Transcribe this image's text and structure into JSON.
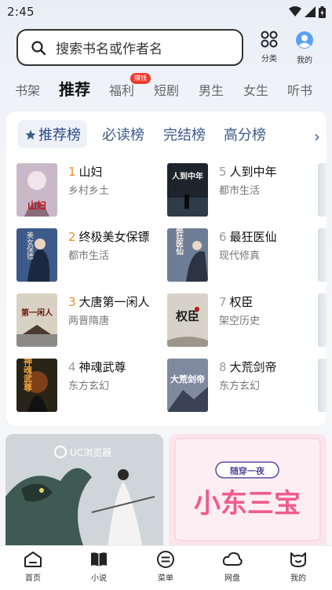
{
  "status": {
    "time": "2:45"
  },
  "search": {
    "placeholder": "搜索书名或作者名",
    "category_label": "分类",
    "profile_label": "我的"
  },
  "tabs": [
    {
      "label": "书架"
    },
    {
      "label": "推荐",
      "active": true
    },
    {
      "label": "福利",
      "badge": "赚钱"
    },
    {
      "label": "短剧"
    },
    {
      "label": "男生"
    },
    {
      "label": "女生"
    },
    {
      "label": "听书"
    }
  ],
  "ranking": {
    "tabs": [
      "推荐榜",
      "必读榜",
      "完结榜",
      "高分榜"
    ],
    "books": [
      {
        "rank": "1",
        "title": "山妇",
        "tag": "乡村乡土"
      },
      {
        "rank": "2",
        "title": "终极美女保镖",
        "tag": "都市生活"
      },
      {
        "rank": "3",
        "title": "大唐第一闲人",
        "tag": "两晋隋唐"
      },
      {
        "rank": "4",
        "title": "神魂武尊",
        "tag": "东方玄幻"
      },
      {
        "rank": "5",
        "title": "人到中年",
        "tag": "都市生活"
      },
      {
        "rank": "6",
        "title": "最狂医仙",
        "tag": "现代修真"
      },
      {
        "rank": "7",
        "title": "权臣",
        "tag": "架空历史"
      },
      {
        "rank": "8",
        "title": "大荒剑帝",
        "tag": "东方玄幻"
      }
    ],
    "covers": [
      {
        "text": "山妇",
        "bg": "#c9b9c8",
        "fg": "#c0121a"
      },
      {
        "text": "美女保镖",
        "bg": "#3c5a8a",
        "fg": "#f3e9d6"
      },
      {
        "text": "第一闲人",
        "bg": "#d9d2c4",
        "fg": "#6b1a12"
      },
      {
        "text": "神魂武尊",
        "bg": "#2a2418",
        "fg": "#e9a23a"
      },
      {
        "text": "人到中年",
        "bg": "#1e242c",
        "fg": "#f0f0f0"
      },
      {
        "text": "最狂医仙",
        "bg": "#6d7d95",
        "fg": "#f5efe2"
      },
      {
        "text": "权臣",
        "bg": "#d7d2c8",
        "fg": "#1c1c1c"
      },
      {
        "text": "大荒剑帝",
        "bg": "#7f8aa0",
        "fg": "#ffffff"
      }
    ]
  },
  "banners": [
    {
      "brand": "UC浏览器",
      "bg": "#cfd5d8"
    },
    {
      "top_tag": "随穿一夜",
      "title": "小东三宝",
      "bg": "#fbe4ec"
    }
  ],
  "bottom_nav": [
    {
      "label": "首页"
    },
    {
      "label": "小说",
      "active": true
    },
    {
      "label": "菜单"
    },
    {
      "label": "网盘"
    },
    {
      "label": "我的"
    }
  ]
}
